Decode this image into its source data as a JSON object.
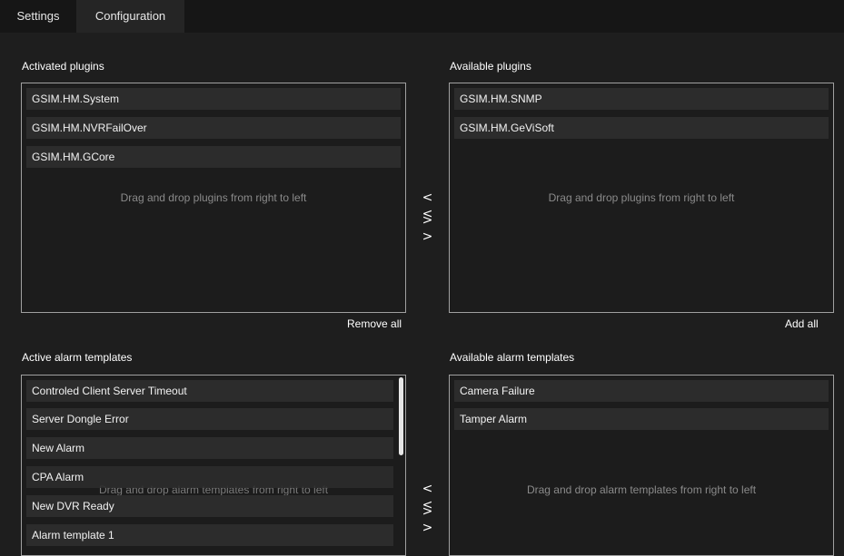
{
  "tabs": [
    {
      "label": "Settings"
    },
    {
      "label": "Configuration"
    }
  ],
  "plugins": {
    "activated_label": "Activated plugins",
    "available_label": "Available plugins",
    "activated_items": [
      "GSIM.HM.System",
      "GSIM.HM.NVRFailOver",
      "GSIM.HM.GCore"
    ],
    "available_items": [
      "GSIM.HM.SNMP",
      "GSIM.HM.GeViSoft"
    ],
    "hint": "Drag and drop plugins from right to left",
    "remove_all": "Remove all",
    "add_all": "Add all",
    "move_left": "< <",
    "move_right": "> >"
  },
  "alarm_templates": {
    "active_label": "Active alarm templates",
    "available_label": "Available alarm templates",
    "active_items": [
      "Controled Client Server Timeout",
      "Server Dongle Error",
      "New Alarm",
      "CPA Alarm",
      "New DVR Ready",
      "Alarm template 1"
    ],
    "available_items": [
      "Camera Failure",
      "Tamper Alarm"
    ],
    "hint": "Drag and drop alarm templates from right to left",
    "move_left": "< <",
    "move_right": "> >"
  }
}
